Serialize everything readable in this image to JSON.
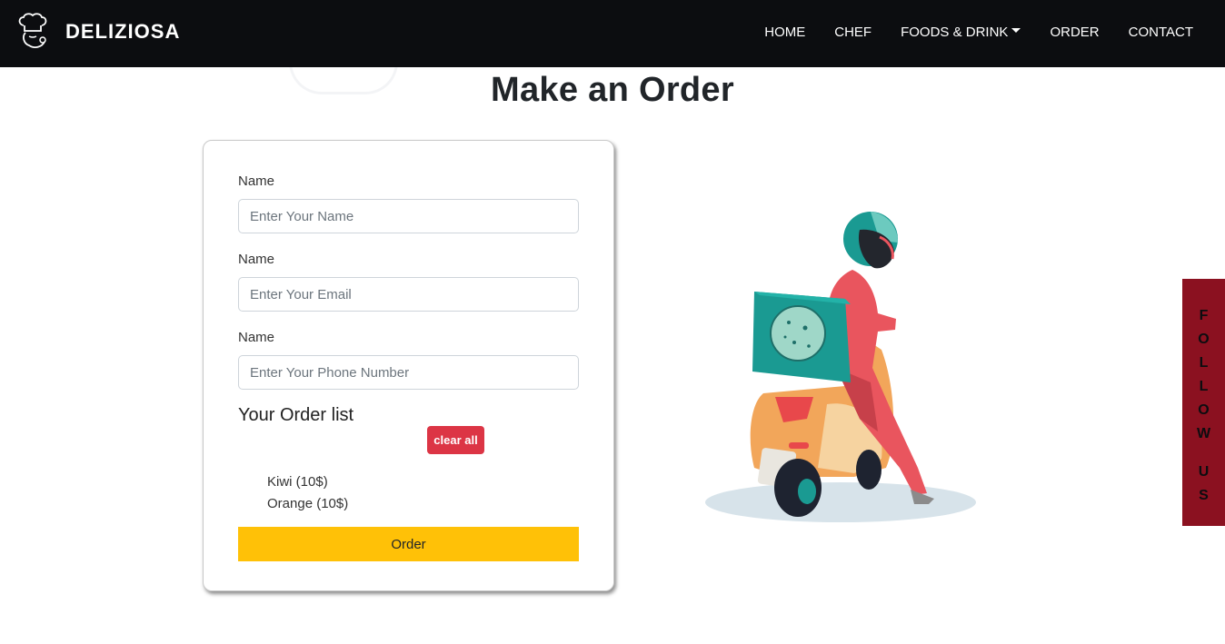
{
  "brand": {
    "name": "DELIZIOSA",
    "logo_icon": "chef-hat-icon"
  },
  "nav": {
    "items": [
      {
        "label": "HOME"
      },
      {
        "label": "CHEF"
      },
      {
        "label": "FOODS & DRINK",
        "dropdown": true
      },
      {
        "label": "ORDER"
      },
      {
        "label": "CONTACT"
      }
    ]
  },
  "page": {
    "title": "Make an Order"
  },
  "form": {
    "fields": [
      {
        "label": "Name",
        "placeholder": "Enter Your Name",
        "value": ""
      },
      {
        "label": "Name",
        "placeholder": "Enter Your Email",
        "value": ""
      },
      {
        "label": "Name",
        "placeholder": "Enter Your Phone Number",
        "value": ""
      }
    ],
    "order_list_heading": "Your Order list",
    "clear_label": "clear all",
    "order_items": [
      "Kiwi (10$)",
      "Orange (10$)"
    ],
    "submit_label": "Order"
  },
  "illustration": {
    "icon": "delivery-scooter-illustration"
  },
  "follow": {
    "label": "FOLLOW US",
    "letters": [
      "F",
      "O",
      "L",
      "L",
      "O",
      "W",
      "",
      "U",
      "S"
    ]
  },
  "colors": {
    "navbar": "#0c0d10",
    "danger": "#dc3545",
    "warning": "#ffc107",
    "follow_bg": "#8b1120"
  }
}
